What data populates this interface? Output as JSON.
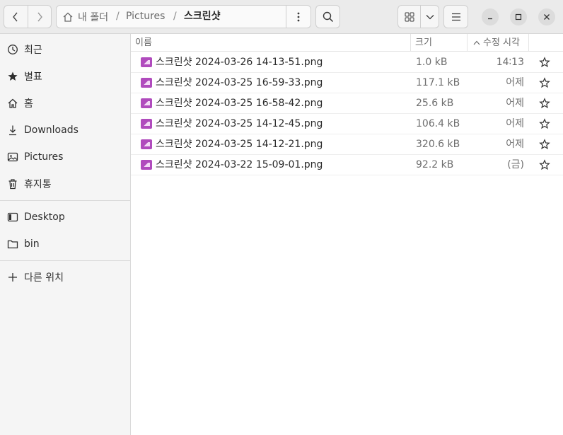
{
  "path": {
    "home_label": "내 폴더",
    "crumbs": [
      "Pictures",
      "스크린샷"
    ],
    "separator": "/"
  },
  "sidebar": {
    "items": [
      {
        "label": "최근",
        "icon": "clock-icon"
      },
      {
        "label": "별표",
        "icon": "star-icon"
      },
      {
        "label": "홈",
        "icon": "home-icon"
      },
      {
        "label": "Downloads",
        "icon": "download-icon"
      },
      {
        "label": "Pictures",
        "icon": "pictures-icon"
      },
      {
        "label": "휴지통",
        "icon": "trash-icon"
      }
    ],
    "bookmarks": [
      {
        "label": "Desktop",
        "icon": "desktop-icon"
      },
      {
        "label": "bin",
        "icon": "folder-icon"
      }
    ],
    "other_locations": {
      "label": "다른 위치",
      "icon": "plus-icon"
    }
  },
  "columns": {
    "name": "이름",
    "size": "크기",
    "modified": "수정 시각",
    "sort_indicator": "^"
  },
  "files": [
    {
      "name": "스크린샷 2024-03-26 14-13-51.png",
      "size": "1.0 kB",
      "modified": "14∶13",
      "starred": false
    },
    {
      "name": "스크린샷 2024-03-25 16-59-33.png",
      "size": "117.1 kB",
      "modified": "어제",
      "starred": false
    },
    {
      "name": "스크린샷 2024-03-25 16-58-42.png",
      "size": "25.6 kB",
      "modified": "어제",
      "starred": false
    },
    {
      "name": "스크린샷 2024-03-25 14-12-45.png",
      "size": "106.4 kB",
      "modified": "어제",
      "starred": false
    },
    {
      "name": "스크린샷 2024-03-25 14-12-21.png",
      "size": "320.6 kB",
      "modified": "어제",
      "starred": false
    },
    {
      "name": "스크린샷 2024-03-22 15-09-01.png",
      "size": "92.2 kB",
      "modified": "(금)",
      "starred": false
    }
  ],
  "colors": {
    "accent_file_icon": "#b04bbd",
    "sidebar_bg": "#f5f5f5",
    "header_bg": "#ebebeb"
  }
}
